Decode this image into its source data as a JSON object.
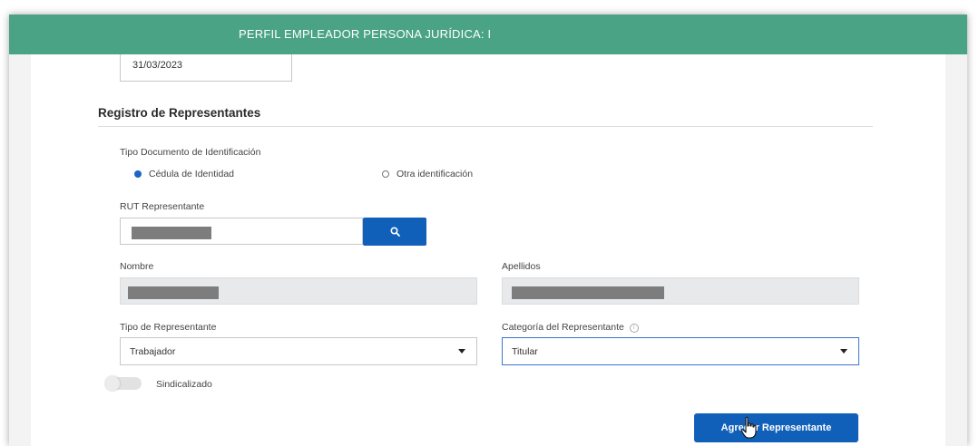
{
  "header": {
    "title": "PERFIL EMPLEADOR PERSONA JURÍDICA: I"
  },
  "form": {
    "date_value": "31/03/2023",
    "section_title": "Registro de Representantes",
    "doc_type": {
      "label": "Tipo Documento de Identificación",
      "options": [
        {
          "label": "Cédula de Identidad",
          "selected": true
        },
        {
          "label": "Otra identificación",
          "selected": false
        }
      ]
    },
    "rut": {
      "label": "RUT Representante",
      "value": ""
    },
    "nombre": {
      "label": "Nombre",
      "value": ""
    },
    "apellidos": {
      "label": "Apellidos",
      "value": ""
    },
    "tipo_representante": {
      "label": "Tipo de Representante",
      "selected": "Trabajador"
    },
    "categoria_representante": {
      "label": "Categoría del Representante",
      "selected": "Titular"
    },
    "sindicalizado": {
      "label": "Sindicalizado",
      "checked": false
    },
    "add_button_label": "Agregar Representante"
  },
  "icons": {
    "search": "search-icon",
    "info": "info-icon",
    "cursor": "hand-cursor-icon",
    "caret": "chevron-down-icon"
  },
  "colors": {
    "header_bg": "#4aa385",
    "primary_button": "#1060b9",
    "radio_selected": "#1e63c8"
  }
}
